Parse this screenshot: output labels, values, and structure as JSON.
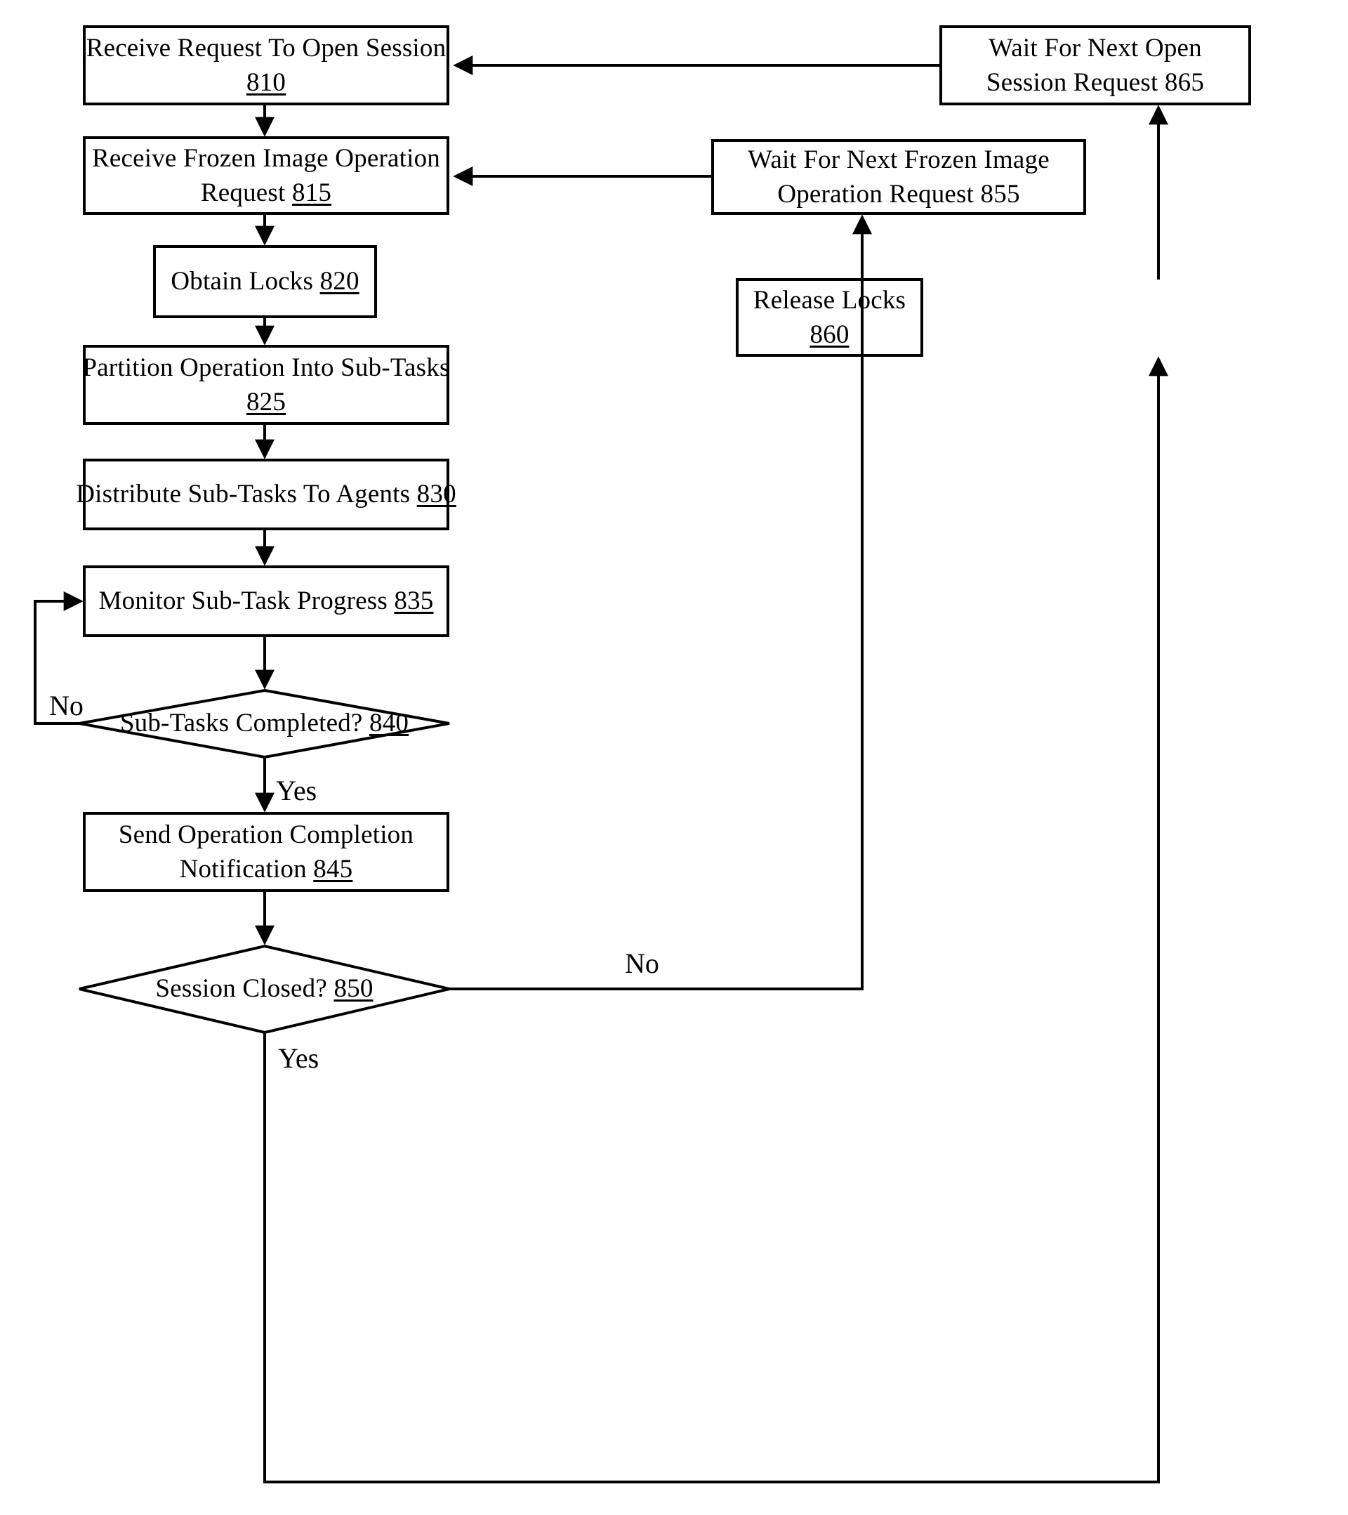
{
  "diagram": {
    "type": "flowchart",
    "figure_label": "",
    "background_color": "#ffffff",
    "line_color": "#000000",
    "nodes": [
      {
        "id": "n810",
        "shape": "rectangle",
        "ref": "810",
        "lines": [
          "Receive Request To Open Session",
          "810"
        ],
        "text": "Receive Request To Open Session 810"
      },
      {
        "id": "n865",
        "shape": "rectangle",
        "ref": "865",
        "lines": [
          "Wait For Next Open",
          "Session Request 865"
        ],
        "text": "Wait For Next Open Session Request 865"
      },
      {
        "id": "n815",
        "shape": "rectangle",
        "ref": "815",
        "lines": [
          "Receive Frozen Image Operation",
          "Request 815"
        ],
        "text": "Receive Frozen Image Operation Request 815"
      },
      {
        "id": "n855",
        "shape": "rectangle",
        "ref": "855",
        "lines": [
          "Wait For Next Frozen Image",
          "Operation Request 855"
        ],
        "text": "Wait For Next Frozen Image Operation Request 855"
      },
      {
        "id": "n820",
        "shape": "rectangle",
        "ref": "820",
        "lines": [
          "Obtain Locks 820"
        ],
        "text": "Obtain Locks 820"
      },
      {
        "id": "n860",
        "shape": "rectangle",
        "ref": "860",
        "lines": [
          "Release Locks",
          "860"
        ],
        "text": "Release Locks 860"
      },
      {
        "id": "n825",
        "shape": "rectangle",
        "ref": "825",
        "lines": [
          "Partition Operation Into Sub-Tasks",
          "825"
        ],
        "text": "Partition Operation Into Sub-Tasks 825"
      },
      {
        "id": "n830",
        "shape": "rectangle",
        "ref": "830",
        "lines": [
          "Distribute Sub-Tasks To Agents 830"
        ],
        "text": "Distribute Sub-Tasks To Agents 830"
      },
      {
        "id": "n835",
        "shape": "rectangle",
        "ref": "835",
        "lines": [
          "Monitor Sub-Task Progress 835"
        ],
        "text": "Monitor Sub-Task Progress 835"
      },
      {
        "id": "n840",
        "shape": "diamond",
        "ref": "840",
        "lines": [
          "Sub-Tasks Completed? 840"
        ],
        "text": "Sub-Tasks Completed? 840"
      },
      {
        "id": "n845",
        "shape": "rectangle",
        "ref": "845",
        "lines": [
          "Send Operation Completion",
          "Notification 845"
        ],
        "text": "Send Operation Completion Notification 845"
      },
      {
        "id": "n850",
        "shape": "diamond",
        "ref": "850",
        "lines": [
          "Session Closed? 850"
        ],
        "text": "Session Closed? 850"
      }
    ],
    "edge_labels": [
      {
        "id": "lbl-840-no",
        "text": "No"
      },
      {
        "id": "lbl-840-yes",
        "text": "Yes"
      },
      {
        "id": "lbl-850-no",
        "text": "No"
      },
      {
        "id": "lbl-850-yes",
        "text": "Yes"
      }
    ],
    "edges": [
      {
        "from": "n810",
        "to": "n815",
        "label": ""
      },
      {
        "from": "n815",
        "to": "n820",
        "label": ""
      },
      {
        "from": "n820",
        "to": "n825",
        "label": ""
      },
      {
        "from": "n825",
        "to": "n830",
        "label": ""
      },
      {
        "from": "n830",
        "to": "n835",
        "label": ""
      },
      {
        "from": "n835",
        "to": "n840",
        "label": ""
      },
      {
        "from": "n840",
        "to": "n835",
        "label": "No"
      },
      {
        "from": "n840",
        "to": "n845",
        "label": "Yes"
      },
      {
        "from": "n845",
        "to": "n850",
        "label": ""
      },
      {
        "from": "n850",
        "to": "n855",
        "label": "No"
      },
      {
        "from": "n850",
        "to": "n860",
        "label": "Yes"
      },
      {
        "from": "n855",
        "to": "n815",
        "label": ""
      },
      {
        "from": "n860",
        "to": "n865",
        "label": ""
      },
      {
        "from": "n865",
        "to": "n810",
        "label": ""
      }
    ]
  }
}
